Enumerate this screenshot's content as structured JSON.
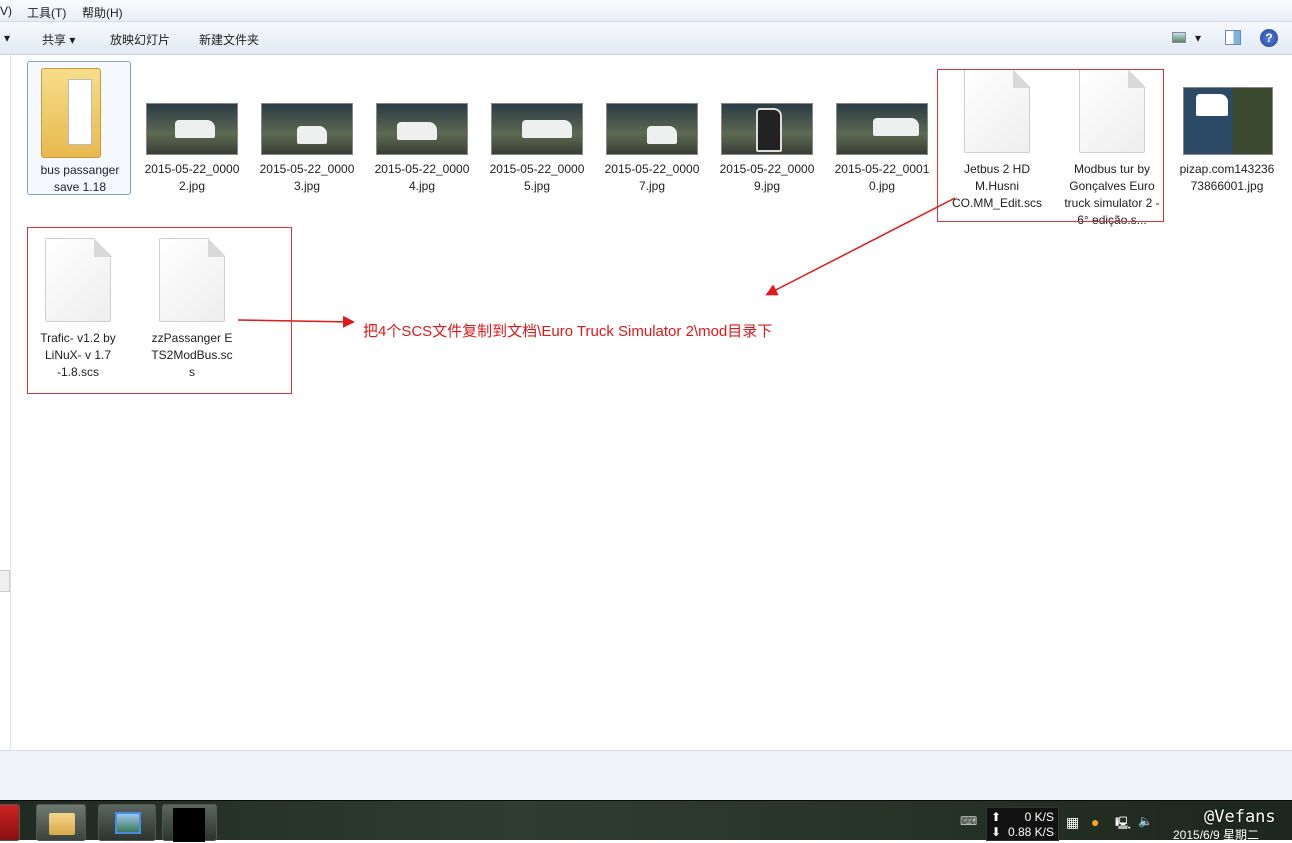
{
  "menu": {
    "items": [
      "V)",
      "工具(T)",
      "帮助(H)"
    ]
  },
  "toolbar": {
    "share": "共享 ▾",
    "slideshow": "放映幻灯片",
    "new_folder": "新建文件夹",
    "view_arrow": "▾",
    "help": "?"
  },
  "files_row1": [
    {
      "name": "bus passanger save 1.18",
      "type": "folder"
    },
    {
      "name": "2015-05-22_00002.jpg",
      "type": "image"
    },
    {
      "name": "2015-05-22_00003.jpg",
      "type": "image"
    },
    {
      "name": "2015-05-22_00004.jpg",
      "type": "image"
    },
    {
      "name": "2015-05-22_00005.jpg",
      "type": "image"
    },
    {
      "name": "2015-05-22_00007.jpg",
      "type": "image"
    },
    {
      "name": "2015-05-22_00009.jpg",
      "type": "image"
    },
    {
      "name": "2015-05-22_00010.jpg",
      "type": "image"
    },
    {
      "name": "Jetbus 2 HD M.Husni CO.MM_Edit.scs",
      "type": "file"
    },
    {
      "name": "Modbus tur by Gonçalves Euro truck simulator 2 - 6° edição.s...",
      "type": "file"
    },
    {
      "name": "pizap.com14323673866001.jpg",
      "type": "image"
    }
  ],
  "files_row2": [
    {
      "name": "Trafic- v1.2 by LiNuX- v 1.7 -1.8.scs",
      "type": "file"
    },
    {
      "name": "zzPassanger ETS2ModBus.scs",
      "type": "file"
    }
  ],
  "annotation": {
    "text": "把4个SCS文件复制到文档\\Euro Truck Simulator 2\\mod目录下",
    "color": "#e01818"
  },
  "tray": {
    "upload": "0 K/S",
    "download": "0.88 K/S",
    "date": "2015/6/9 星期二",
    "watermark": "@Vefans"
  }
}
